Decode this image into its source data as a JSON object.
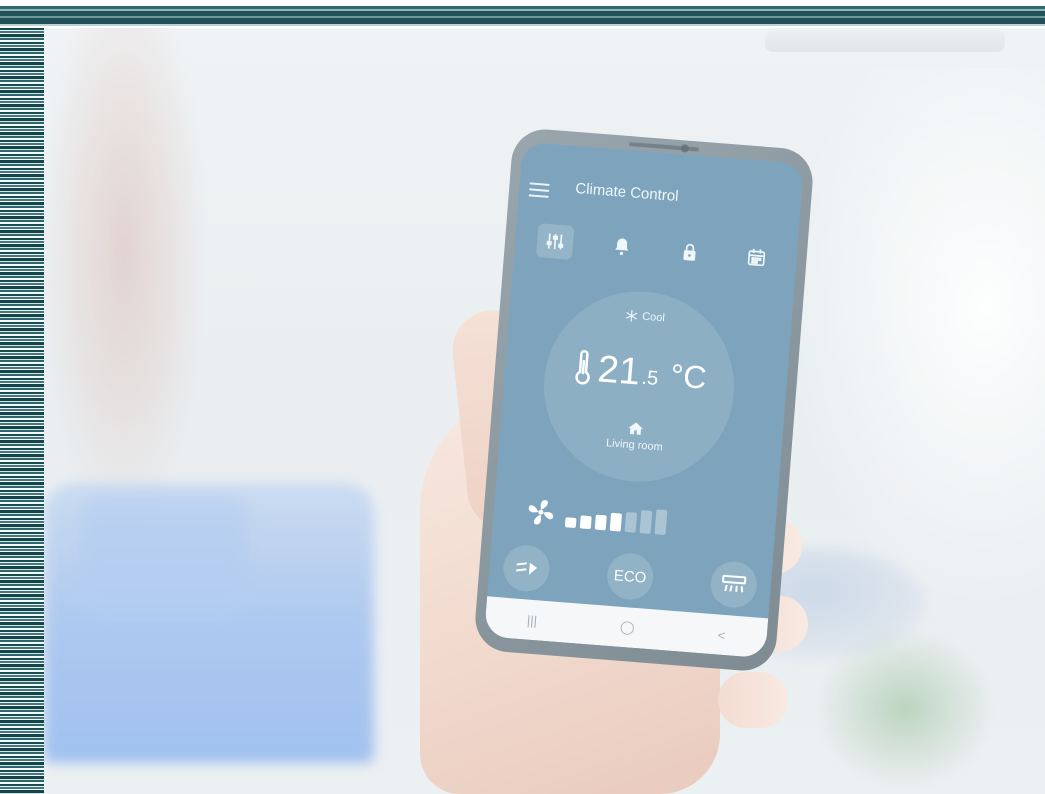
{
  "app": {
    "title": "Climate Control"
  },
  "tabs": [
    {
      "icon": "sliders-icon",
      "active": true
    },
    {
      "icon": "bell-icon",
      "active": false
    },
    {
      "icon": "lock-icon",
      "active": false
    },
    {
      "icon": "calendar-icon",
      "active": false
    }
  ],
  "thermostat": {
    "mode_label": "Cool",
    "temp_integer": "21",
    "temp_decimal": ".5",
    "unit": "°C",
    "room_label": "Living room"
  },
  "fan": {
    "levels_total": 7,
    "levels_active": 4
  },
  "controls": {
    "eco_label": "ECO"
  },
  "nav": {
    "recent": "|||",
    "home": "◯",
    "back": "<"
  },
  "colors": {
    "screen_bg": "#6c98b3",
    "accent": "#ffffff",
    "stripe_dark": "#1f5358"
  }
}
